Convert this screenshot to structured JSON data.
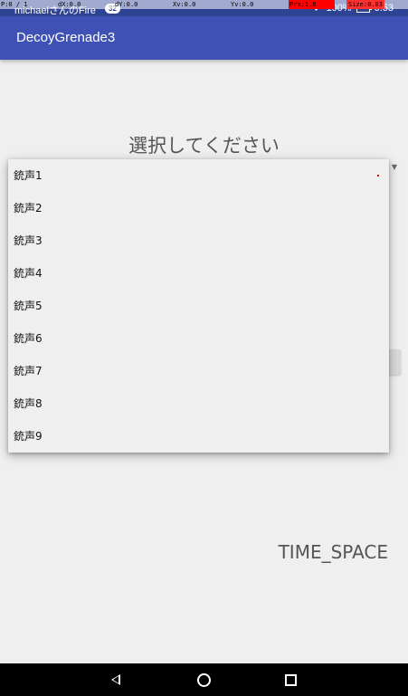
{
  "pointer_location": {
    "p": "P:0 / 1",
    "dx": "dX:0.0",
    "dy": "dY:0.0",
    "xv": "Xv:0.0",
    "yv": "Yv:0.0",
    "prs": "Prs:1.0",
    "size": "Size:0.03"
  },
  "status_bar": {
    "device_name": "michaelさんのFire",
    "badge": "32",
    "battery": "100%",
    "time": "0:53"
  },
  "app_bar": {
    "title": "DecoyGrenade3"
  },
  "main": {
    "prompt": "選択してください",
    "time_space": "TIME_SPACE"
  },
  "dropdown": {
    "items": [
      "銃声1",
      "銃声2",
      "銃声3",
      "銃声4",
      "銃声5",
      "銃声6",
      "銃声7",
      "銃声8",
      "銃声9"
    ]
  },
  "nav_bar": {
    "icons": [
      "back-icon",
      "home-icon",
      "recents-icon"
    ]
  }
}
